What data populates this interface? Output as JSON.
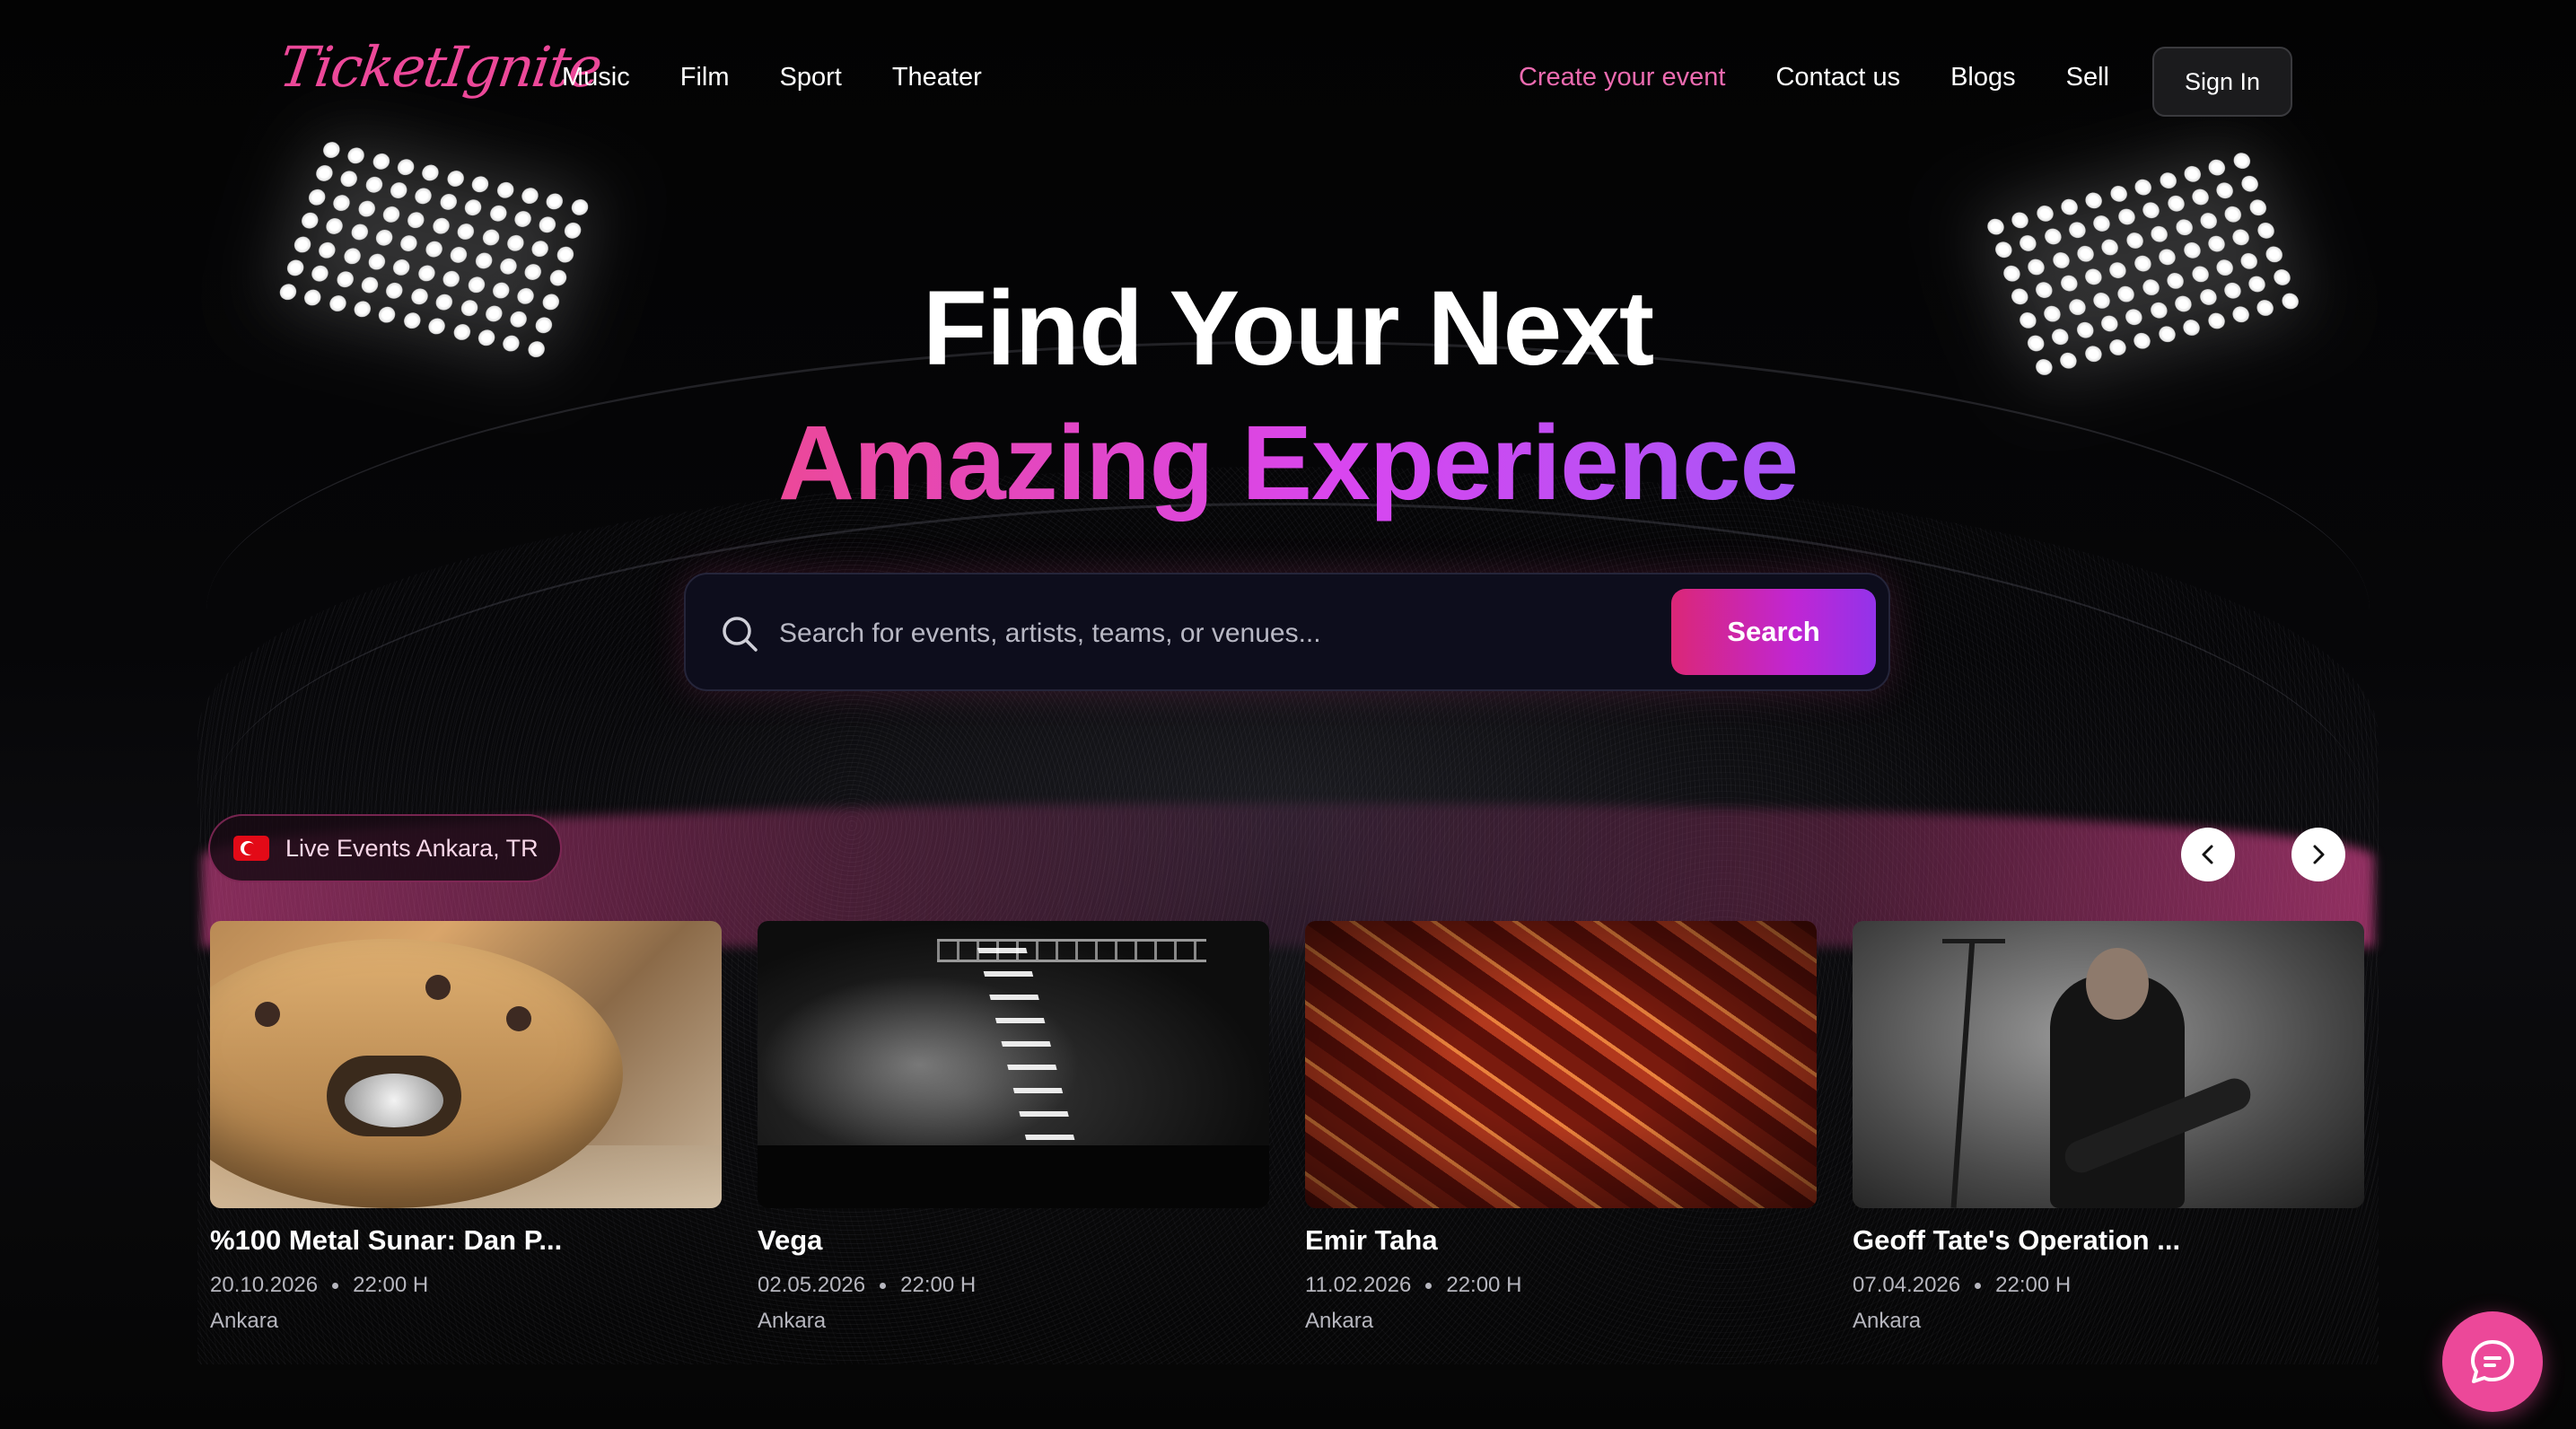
{
  "brand": {
    "logo_text": "TicketIgnite",
    "accent": "#ec4899",
    "accent_purple": "#a855f7"
  },
  "nav": {
    "left": [
      "Music",
      "Film",
      "Sport",
      "Theater"
    ],
    "right": [
      "Create your event",
      "Contact us",
      "Blogs",
      "Sell"
    ],
    "sign_in": "Sign In"
  },
  "hero": {
    "line1": "Find Your Next",
    "line2": "Amazing Experience"
  },
  "search": {
    "placeholder": "Search for events, artists, teams, or venues...",
    "value": "",
    "button": "Search",
    "icon": "search-icon"
  },
  "live": {
    "label": "Live Events Ankara, TR",
    "flag": "turkey-flag-icon",
    "prev_icon": "chevron-left-icon",
    "next_icon": "chevron-right-icon"
  },
  "events": [
    {
      "title": "%100 Metal Sunar: Dan P...",
      "date": "20.10.2026",
      "time": "22:00 H",
      "city": "Ankara"
    },
    {
      "title": "Vega",
      "date": "02.05.2026",
      "time": "22:00 H",
      "city": "Ankara"
    },
    {
      "title": "Emir Taha",
      "date": "11.02.2026",
      "time": "22:00 H",
      "city": "Ankara"
    },
    {
      "title": "Geoff Tate's Operation ...",
      "date": "07.04.2026",
      "time": "22:00 H",
      "city": "Ankara"
    }
  ],
  "chat": {
    "icon": "chat-icon"
  }
}
